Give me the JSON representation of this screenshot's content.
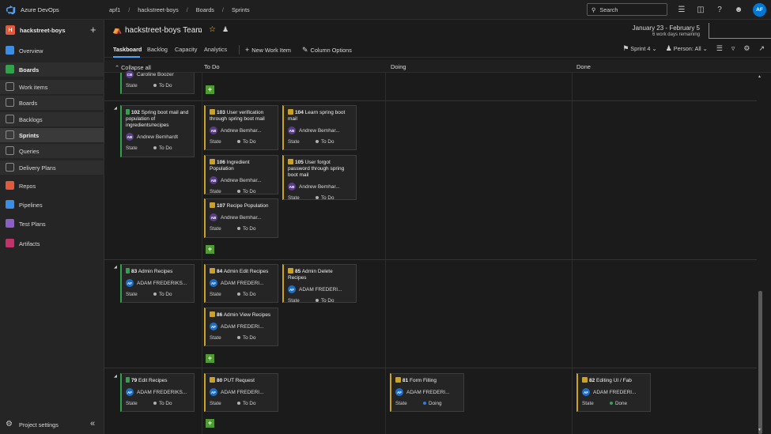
{
  "app": {
    "name": "Azure DevOps",
    "user_initials": "AF"
  },
  "breadcrumbs": [
    "apf1",
    "hackstreet-boys",
    "Boards",
    "Sprints"
  ],
  "search": {
    "placeholder": "Search"
  },
  "sidebar": {
    "project_name": "hackstreet-boys",
    "project_initial": "H",
    "items": [
      {
        "label": "Overview",
        "icon": "overview-icon",
        "color": "#3a8ee6"
      },
      {
        "label": "Boards",
        "icon": "boards-icon",
        "color": "#2fa34a"
      },
      {
        "label": "Work items",
        "icon": "work-items-icon",
        "color": "#8a8a8a"
      },
      {
        "label": "Boards",
        "icon": "board-icon",
        "color": "#8a8a8a"
      },
      {
        "label": "Backlogs",
        "icon": "backlogs-icon",
        "color": "#8a8a8a"
      },
      {
        "label": "Sprints",
        "icon": "sprints-icon",
        "color": "#8a8a8a"
      },
      {
        "label": "Queries",
        "icon": "queries-icon",
        "color": "#8a8a8a"
      },
      {
        "label": "Delivery Plans",
        "icon": "delivery-plans-icon",
        "color": "#8a8a8a"
      },
      {
        "label": "Repos",
        "icon": "repos-icon",
        "color": "#e05a3b"
      },
      {
        "label": "Pipelines",
        "icon": "pipelines-icon",
        "color": "#3a8ee6"
      },
      {
        "label": "Test Plans",
        "icon": "test-plans-icon",
        "color": "#8b5fc7"
      },
      {
        "label": "Artifacts",
        "icon": "artifacts-icon",
        "color": "#c2336b"
      }
    ],
    "settings_label": "Project settings"
  },
  "team": {
    "name": "hackstreet-boys Team",
    "dates": "January 23 - February 5",
    "remaining": "6 work days remaining"
  },
  "tabs": [
    "Taskboard",
    "Backlog",
    "Capacity",
    "Analytics"
  ],
  "actions": {
    "new_item": "New Work Item",
    "column_options": "Column Options"
  },
  "toolbar": {
    "sprint": "Sprint 4",
    "person": "Person: All"
  },
  "board": {
    "collapse_all": "Collapse all",
    "columns": [
      "To Do",
      "Doing",
      "Done"
    ],
    "state_label": "State",
    "partial_card_assignee": "Caroline Boozer",
    "partial_card_state": "To Do",
    "stories": [
      {
        "id": "102",
        "title": "Spring boot mail and population of ingredients/recipes",
        "assignee": "Andrew Bemhardt",
        "initials": "AB",
        "state": "To Do"
      },
      {
        "id": "83",
        "title": "Admin Recipes",
        "assignee": "ADAM FREDERIKS...",
        "initials": "AF",
        "state": "To Do"
      },
      {
        "id": "79",
        "title": "Edit Recipes",
        "assignee": "ADAM FREDERIKS...",
        "initials": "AF",
        "state": "To Do"
      }
    ],
    "tasks": [
      {
        "id": "103",
        "title": "User verification through spring boot mail",
        "assignee": "Andrew Bemhar...",
        "initials": "AB",
        "state": "To Do"
      },
      {
        "id": "104",
        "title": "Learn spring boot mail",
        "assignee": "Andrew Bemhar...",
        "initials": "AB",
        "state": "To Do"
      },
      {
        "id": "106",
        "title": "Ingredient Population",
        "assignee": "Andrew Bemhar...",
        "initials": "AB",
        "state": "To Do"
      },
      {
        "id": "105",
        "title": "User forgot password through spring boot mail",
        "assignee": "Andrew Bemhar...",
        "initials": "AB",
        "state": "To Do"
      },
      {
        "id": "107",
        "title": "Recipe Population",
        "assignee": "Andrew Bemhar...",
        "initials": "AB",
        "state": "To Do"
      },
      {
        "id": "84",
        "title": "Admin Edit Recipes",
        "assignee": "ADAM FREDERI...",
        "initials": "AF",
        "state": "To Do"
      },
      {
        "id": "85",
        "title": "Admin Delete Recipes",
        "assignee": "ADAM FREDERI...",
        "initials": "AF",
        "state": "To Do"
      },
      {
        "id": "86",
        "title": "Admin View Recipes",
        "assignee": "ADAM FREDERI...",
        "initials": "AF",
        "state": "To Do"
      },
      {
        "id": "80",
        "title": "PUT Request",
        "assignee": "ADAM FREDERI...",
        "initials": "AF",
        "state": "To Do"
      },
      {
        "id": "81",
        "title": "Form Filling",
        "assignee": "ADAM FREDERI...",
        "initials": "AF",
        "state": "Doing"
      },
      {
        "id": "82",
        "title": "Editing UI / Fab",
        "assignee": "ADAM FREDERI...",
        "initials": "AF",
        "state": "Done"
      }
    ]
  }
}
